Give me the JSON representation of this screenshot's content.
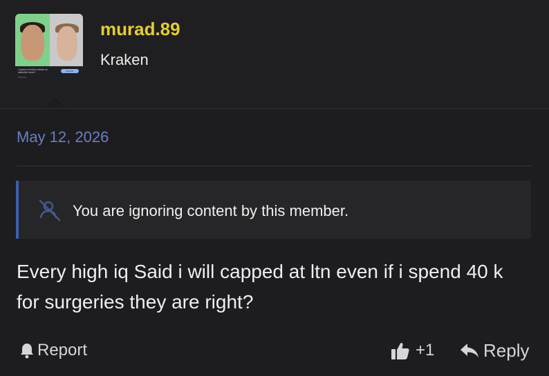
{
  "author": {
    "username": "murad.89",
    "title": "Kraken",
    "avatar_caption": "2 types of hollow cheeks on attractive faces?",
    "avatar_source": "Pinterest",
    "avatar_button": "Expand"
  },
  "post": {
    "date": "May 12, 2026",
    "ignore_notice": "You are ignoring content by this member.",
    "message": "Every high iq Said i will capped at ltn even if i spend 40 k for surgeries they are right?"
  },
  "actions": {
    "report_label": "Report",
    "like_count": "+1",
    "reply_label": "Reply"
  },
  "colors": {
    "username": "#e5cd33",
    "date": "#6a7ec2",
    "notice_accent": "#3d5fae",
    "background": "#1d1d1f"
  },
  "icons": {
    "report": "bell-icon",
    "ignore": "muted-user-icon",
    "like": "thumbs-up-icon",
    "reply": "reply-arrow-icon"
  }
}
